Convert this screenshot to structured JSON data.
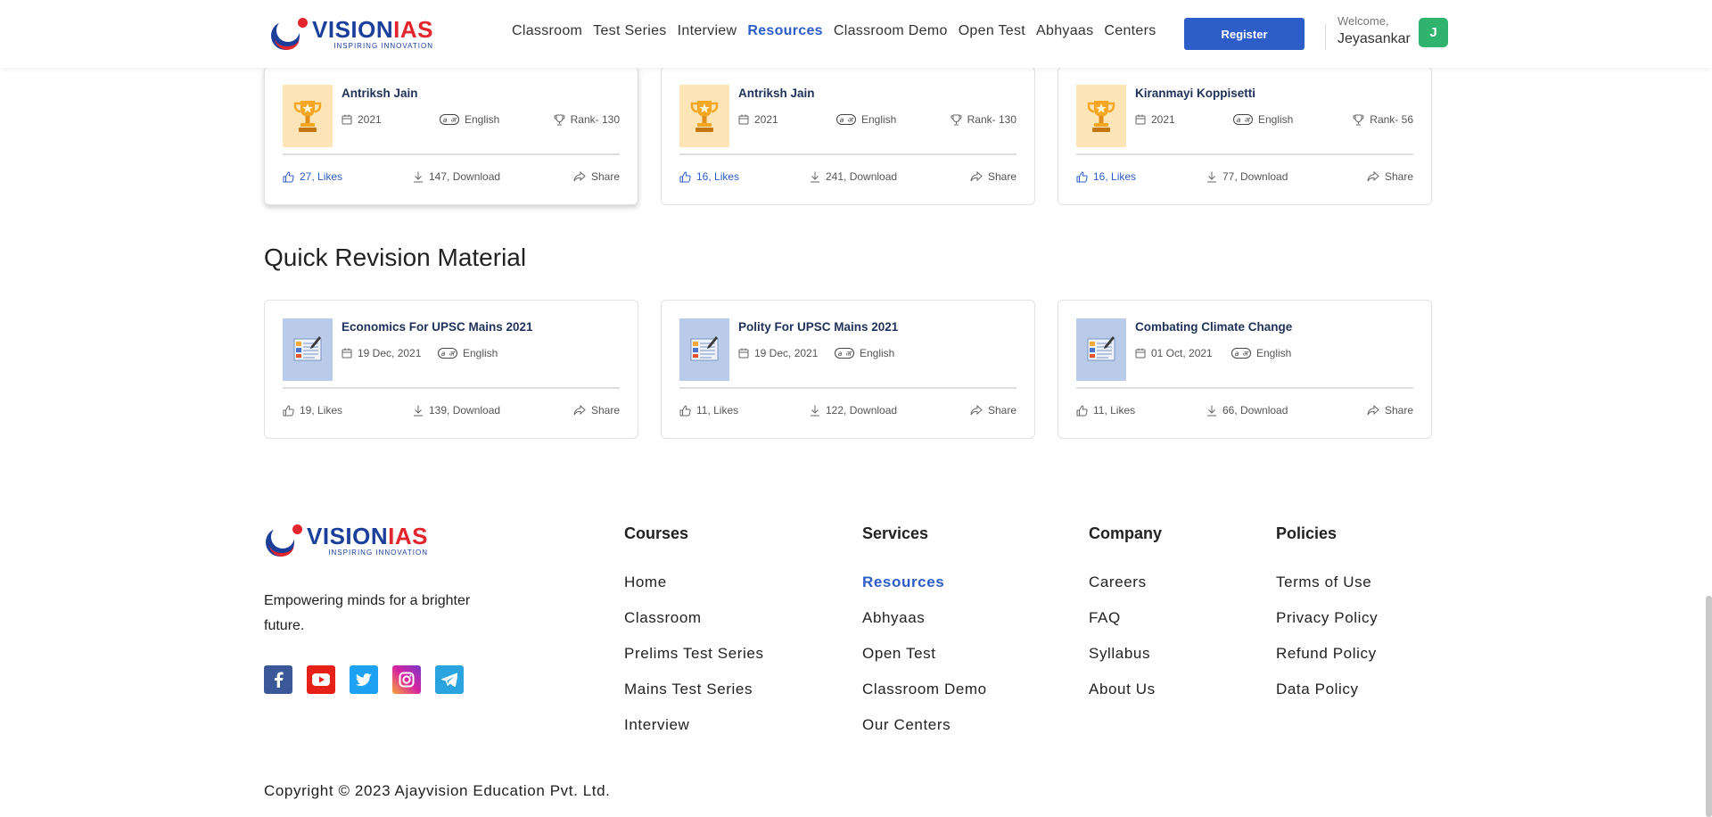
{
  "header": {
    "brand_vision": "VISION",
    "brand_ias": "IAS",
    "tagline": "INSPIRING INNOVATION",
    "nav": [
      "Classroom",
      "Test Series",
      "Interview",
      "Resources",
      "Classroom Demo",
      "Open Test",
      "Abhyaas",
      "Centers"
    ],
    "active_nav": "Resources",
    "register_label": "Register",
    "welcome": "Welcome,",
    "user_name": "Jeyasankar",
    "avatar_initial": "J"
  },
  "toppers": [
    {
      "name": "Antriksh Jain",
      "year": "2021",
      "language": "English",
      "rank": "Rank- 130",
      "likes": "27, Likes",
      "downloads": "147, Download",
      "share": "Share"
    },
    {
      "name": "Antriksh Jain",
      "year": "2021",
      "language": "English",
      "rank": "Rank- 130",
      "likes": "16, Likes",
      "downloads": "241, Download",
      "share": "Share"
    },
    {
      "name": "Kiranmayi Koppisetti",
      "year": "2021",
      "language": "English",
      "rank": "Rank- 56",
      "likes": "16, Likes",
      "downloads": "77, Download",
      "share": "Share"
    }
  ],
  "section_title": "Quick Revision Material",
  "revision": [
    {
      "title": "Economics For UPSC Mains 2021",
      "date": "19 Dec, 2021",
      "language": "English",
      "likes": "19, Likes",
      "downloads": "139, Download",
      "share": "Share"
    },
    {
      "title": "Polity For UPSC Mains 2021",
      "date": "19 Dec, 2021",
      "language": "English",
      "likes": "11, Likes",
      "downloads": "122, Download",
      "share": "Share"
    },
    {
      "title": "Combating Climate Change",
      "date": "01 Oct, 2021",
      "language": "English",
      "likes": "11, Likes",
      "downloads": "66, Download",
      "share": "Share"
    }
  ],
  "footer": {
    "tagline": "Empowering minds for a brighter future.",
    "social": [
      "facebook-icon",
      "youtube-icon",
      "twitter-icon",
      "instagram-icon",
      "telegram-icon"
    ],
    "courses": {
      "title": "Courses",
      "links": [
        "Home",
        "Classroom",
        "Prelims Test Series",
        "Mains Test Series",
        "Interview"
      ]
    },
    "services": {
      "title": "Services",
      "links": [
        "Resources",
        "Abhyaas",
        "Open Test",
        "Classroom Demo",
        "Our Centers"
      ]
    },
    "company": {
      "title": "Company",
      "links": [
        "Careers",
        "FAQ",
        "Syllabus",
        "About Us"
      ]
    },
    "policies": {
      "title": "Policies",
      "links": [
        "Terms of Use",
        "Privacy Policy",
        "Refund Policy",
        "Data Policy"
      ]
    },
    "copyright": "Copyright © 2023 Ajayvision Education Pvt. Ltd."
  },
  "colors": {
    "accent": "#2d5dc9",
    "brand_blue": "#1b3f9a",
    "brand_red": "#e3262d",
    "avatar": "#2fb36d"
  }
}
